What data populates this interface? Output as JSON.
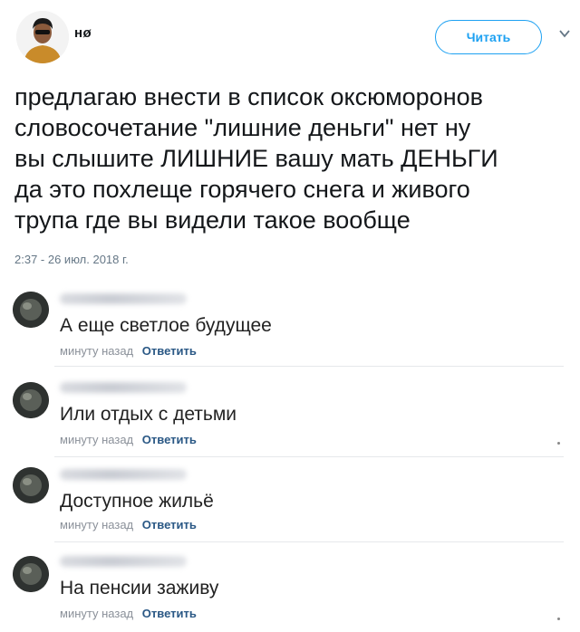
{
  "tweet": {
    "username": "нø",
    "follow_label": "Читать",
    "text": "предлагаю внести в список оксюморонов\nсловосочетание \"лишние деньги\" нет ну\nвы слышите ЛИШНИЕ вашу мать ДЕНЬГИ\nда это похлеще горячего снега и живого\nтрупа где вы видели такое вообще",
    "timestamp": "2:37 - 26 июл. 2018 г."
  },
  "comments": [
    {
      "text": "А еще светлое будущее",
      "time": "минуту назад",
      "reply": "Ответить"
    },
    {
      "text": "Или отдых с детьми",
      "time": "минуту назад",
      "reply": "Ответить"
    },
    {
      "text": "Доступное жильё",
      "time": "минуту назад",
      "reply": "Ответить"
    },
    {
      "text": "На пенсии заживу",
      "time": "минуту назад",
      "reply": "Ответить"
    }
  ],
  "colors": {
    "accent": "#1da1f2",
    "link": "#2a5885"
  }
}
